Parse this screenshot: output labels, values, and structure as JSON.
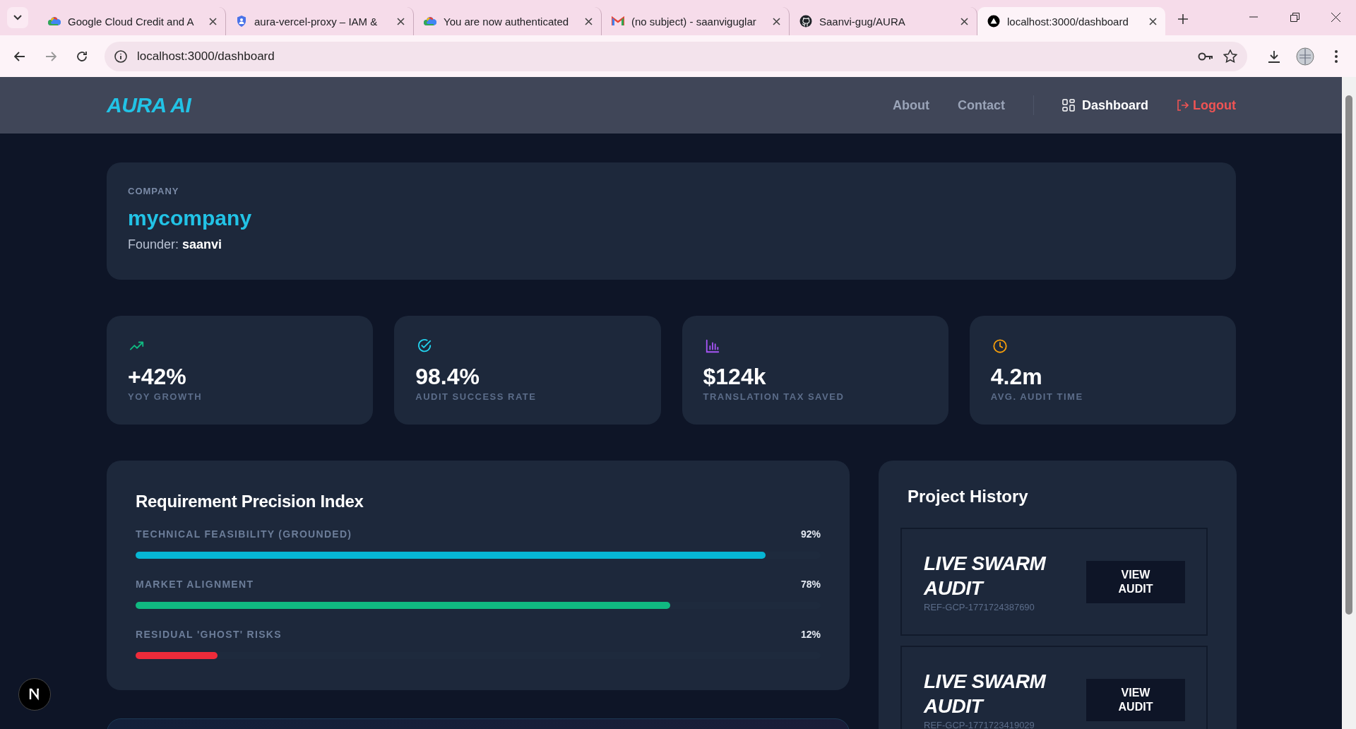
{
  "browser": {
    "tabs": [
      {
        "title": "Google Cloud Credit and A",
        "kind": "cloud",
        "selected": false
      },
      {
        "title": "aura-vercel-proxy – IAM &",
        "kind": "shield",
        "selected": false
      },
      {
        "title": "You are now authenticated",
        "kind": "cloud",
        "selected": false
      },
      {
        "title": "(no subject) - saanviguglar",
        "kind": "mail",
        "selected": false
      },
      {
        "title": "Saanvi-gug/AURA",
        "kind": "github",
        "selected": false
      },
      {
        "title": "localhost:3000/dashboard",
        "kind": "triangle",
        "selected": true
      }
    ],
    "url": "localhost:3000/dashboard"
  },
  "nav": {
    "logo": "AURA AI",
    "links": [
      {
        "label": "About",
        "kind": "link"
      },
      {
        "label": "Contact",
        "kind": "link"
      },
      {
        "label": "Dashboard",
        "kind": "dashboard"
      },
      {
        "label": "Logout",
        "kind": "logout"
      }
    ]
  },
  "company": {
    "label": "COMPANY",
    "name": "mycompany",
    "founder_label": "Founder:",
    "founder": "saanvi"
  },
  "stats": [
    {
      "kind": "growth",
      "color": "#10b981",
      "value": "+42%",
      "label": "YOY GROWTH"
    },
    {
      "kind": "check",
      "color": "#22d3ee",
      "value": "98.4%",
      "label": "AUDIT SUCCESS RATE"
    },
    {
      "kind": "bars",
      "color": "#a855f7",
      "value": "$124k",
      "label": "TRANSLATION TAX SAVED"
    },
    {
      "kind": "clock",
      "color": "#f59e0b",
      "value": "4.2m",
      "label": "AVG. AUDIT TIME"
    }
  ],
  "precision": {
    "title": "Requirement Precision Index",
    "metrics": [
      {
        "label": "TECHNICAL FEASIBILITY (GROUNDED)",
        "reading": "92%",
        "level": 0.92,
        "color": "#06b6d4"
      },
      {
        "label": "MARKET ALIGNMENT",
        "reading": "78%",
        "level": 0.78,
        "color": "#10b981"
      },
      {
        "label": "RESIDUAL 'GHOST' RISKS",
        "reading": "12%",
        "level": 0.12,
        "color": "#ef2b3a"
      }
    ]
  },
  "history": {
    "title": "Project History",
    "projects": [
      {
        "title": "LIVE SWARM AUDIT",
        "ref": "REF-GCP-1771724387690",
        "button": "VIEW AUDIT"
      },
      {
        "title": "LIVE SWARM AUDIT",
        "ref": "REF-GCP-1771723419029",
        "button": "VIEW AUDIT"
      }
    ]
  }
}
